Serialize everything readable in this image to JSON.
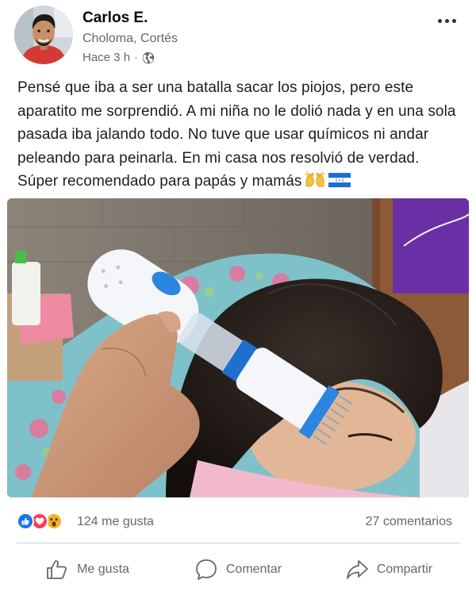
{
  "post": {
    "author": "Carlos E.",
    "location": "Choloma, Cortés",
    "time": "Hace 3 h",
    "time_separator": "·",
    "body": "Pensé que iba a ser una batalla sacar los piojos, pero este aparatito me sorprendió. A mi niña no le dolió nada y en una sola pasada iba jalando todo. No tuve que usar químicos ni andar peleando para peinarla. En mi casa nos resolvió de verdad. Súper recomendado para papás y mamás",
    "body_emojis": [
      "raised-hands-emoji",
      "honduras-flag-emoji"
    ],
    "photo_alt": "hand holding a lice comb device against a girl's wet hair",
    "icons": {
      "privacy": "globe-icon",
      "more": "more-options-icon"
    }
  },
  "stats": {
    "reactions": [
      "like",
      "love",
      "wow"
    ],
    "likes_text": "124 me gusta",
    "comments_text": "27 comentarios"
  },
  "actions": {
    "like_label": "Me gusta",
    "comment_label": "Comentar",
    "share_label": "Compartir"
  },
  "colors": {
    "text_primary": "#050505",
    "text_secondary": "#65676b",
    "like_blue": "#1b74e4",
    "love_red": "#f33e58",
    "wow_yellow": "#f7b125",
    "divider": "#ced0d4"
  }
}
